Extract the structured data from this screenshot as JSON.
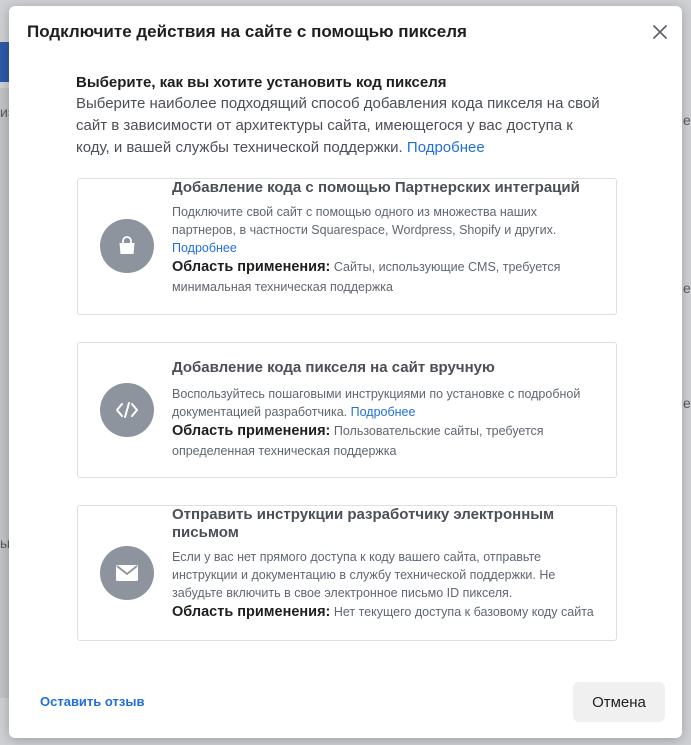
{
  "background": {
    "fragments": [
      "иэ",
      "е",
      "е",
      "ы",
      "е"
    ]
  },
  "dialog": {
    "title": "Подключите действия на сайте с помощью пикселя",
    "intro": {
      "heading": "Выберите, как вы хотите установить код пикселя",
      "text": "Выберите наиболее подходящий способ добавления кода пикселя на свой сайт в зависимости от архитектуры сайта, имеющегося у вас доступа к коду, и вашей службы технической поддержки.",
      "link": "Подробнее"
    },
    "options": [
      {
        "icon": "shopping-bag-icon",
        "title": "Добавление кода с помощью Партнерских интеграций",
        "description": "Подключите свой сайт с помощью одного из множества наших партнеров, в частности Squarespace, Wordpress, Shopify и других.",
        "link": "Подробнее",
        "usage_label": "Область применения:",
        "usage_text": "Сайты, использующие CMS, требуется минимальная техническая поддержка"
      },
      {
        "icon": "code-icon",
        "title": "Добавление кода пикселя на сайт вручную",
        "description": "Воспользуйтесь пошаговыми инструкциями по установке с подробной документацией разработчика.",
        "link": "Подробнее",
        "usage_label": "Область применения:",
        "usage_text": "Пользовательские сайты, требуется определенная техническая поддержка"
      },
      {
        "icon": "envelope-icon",
        "title": "Отправить инструкции разработчику электронным письмом",
        "description": "Если у вас нет прямого доступа к коду вашего сайта, отправьте инструкции и документацию в службу технической поддержки. Не забудьте включить в свое электронное письмо ID пикселя.",
        "link": "",
        "usage_label": "Область применения:",
        "usage_text": "Нет текущего доступа к базовому коду сайта"
      }
    ],
    "footer": {
      "feedback_label": "Оставить отзыв",
      "cancel_label": "Отмена"
    }
  },
  "colors": {
    "link": "#216fdb",
    "icon_circle": "#8d949e",
    "card_border": "#dddfe2"
  }
}
